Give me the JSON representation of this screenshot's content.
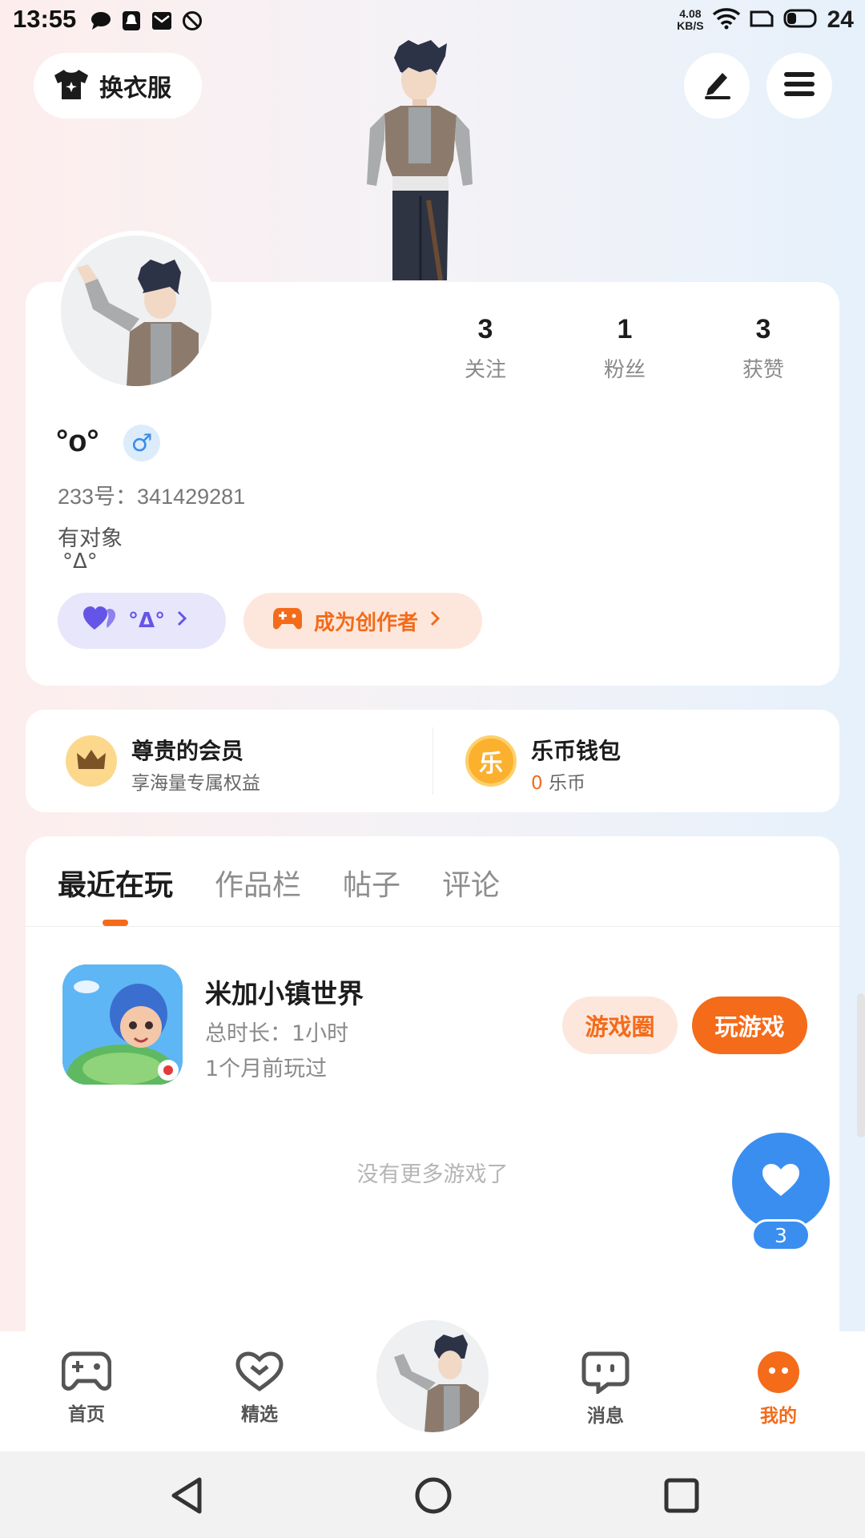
{
  "status_bar": {
    "time": "13:55",
    "net_speed_value": "4.08",
    "net_speed_unit": "KB/S",
    "battery": "24"
  },
  "header": {
    "change_clothes_label": "换衣服"
  },
  "profile": {
    "stats": [
      {
        "value": "3",
        "label": "关注"
      },
      {
        "value": "1",
        "label": "粉丝"
      },
      {
        "value": "3",
        "label": "获赞"
      }
    ],
    "nickname": "°o°",
    "gender_symbol": "♂",
    "uid": "233号：341429281",
    "bio_line1": "有对象",
    "bio_line2": "°Δ°",
    "pill_label": "°Δ°",
    "creator_label": "成为创作者"
  },
  "member": {
    "vip_title": "尊贵的会员",
    "vip_sub": "享海量专属权益",
    "wallet_title": "乐币钱包",
    "wallet_amount": "0",
    "wallet_unit": " 乐币",
    "wallet_icon_char": "乐"
  },
  "tabs": [
    "最近在玩",
    "作品栏",
    "帖子",
    "评论"
  ],
  "game": {
    "name": "米加小镇世界",
    "duration": "总时长：1小时",
    "last_played": "1个月前玩过",
    "circle_button": "游戏圈",
    "play_button": "玩游戏"
  },
  "no_more_text": "没有更多游戏了",
  "fab": {
    "count": "3"
  },
  "bottom_nav": [
    {
      "label": "首页"
    },
    {
      "label": "精选"
    },
    {
      "label": "消息"
    },
    {
      "label": "我的"
    }
  ],
  "colors": {
    "accent": "#f46b1a",
    "blue": "#3a8ef0",
    "purple": "#6555e6"
  }
}
